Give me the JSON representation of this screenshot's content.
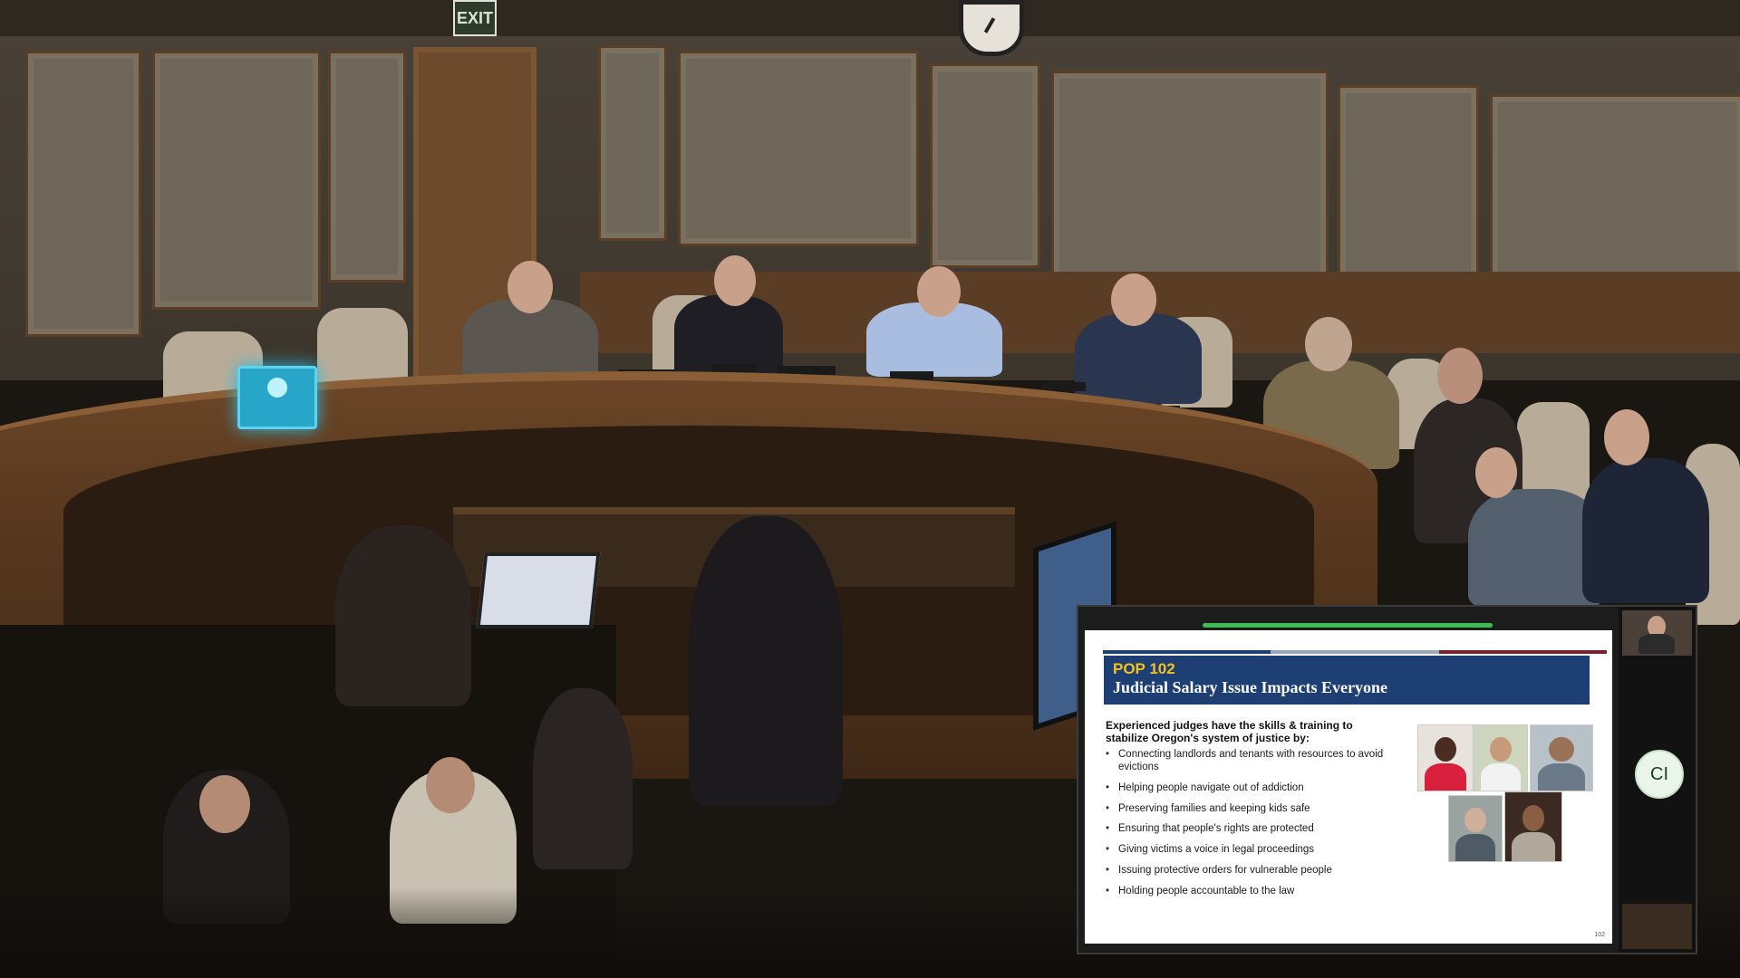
{
  "room": {
    "exit_sign": "EXIT"
  },
  "presentation": {
    "course": "POP 102",
    "title": "Judicial Salary Issue Impacts Everyone",
    "intro": "Experienced judges have the skills & training to stabilize Oregon's system of justice by:",
    "bullets": [
      "Connecting landlords and tenants with resources to avoid evictions",
      "Helping people navigate out of addiction",
      "Preserving families and keeping kids safe",
      "Ensuring that people's rights are protected",
      "Giving victims a voice in legal proceedings",
      "Issuing protective orders for vulnerable people",
      "Holding people accountable to the law"
    ],
    "page_number": "102",
    "colors": {
      "header_bg": "#1e3f73",
      "course_text": "#f4c21a",
      "accent": [
        "#1e3f73",
        "#9aa7b8",
        "#7a1f2b"
      ],
      "progress_bar": "#3cbd52"
    }
  },
  "participants": {
    "avatar_initials": "CI"
  }
}
